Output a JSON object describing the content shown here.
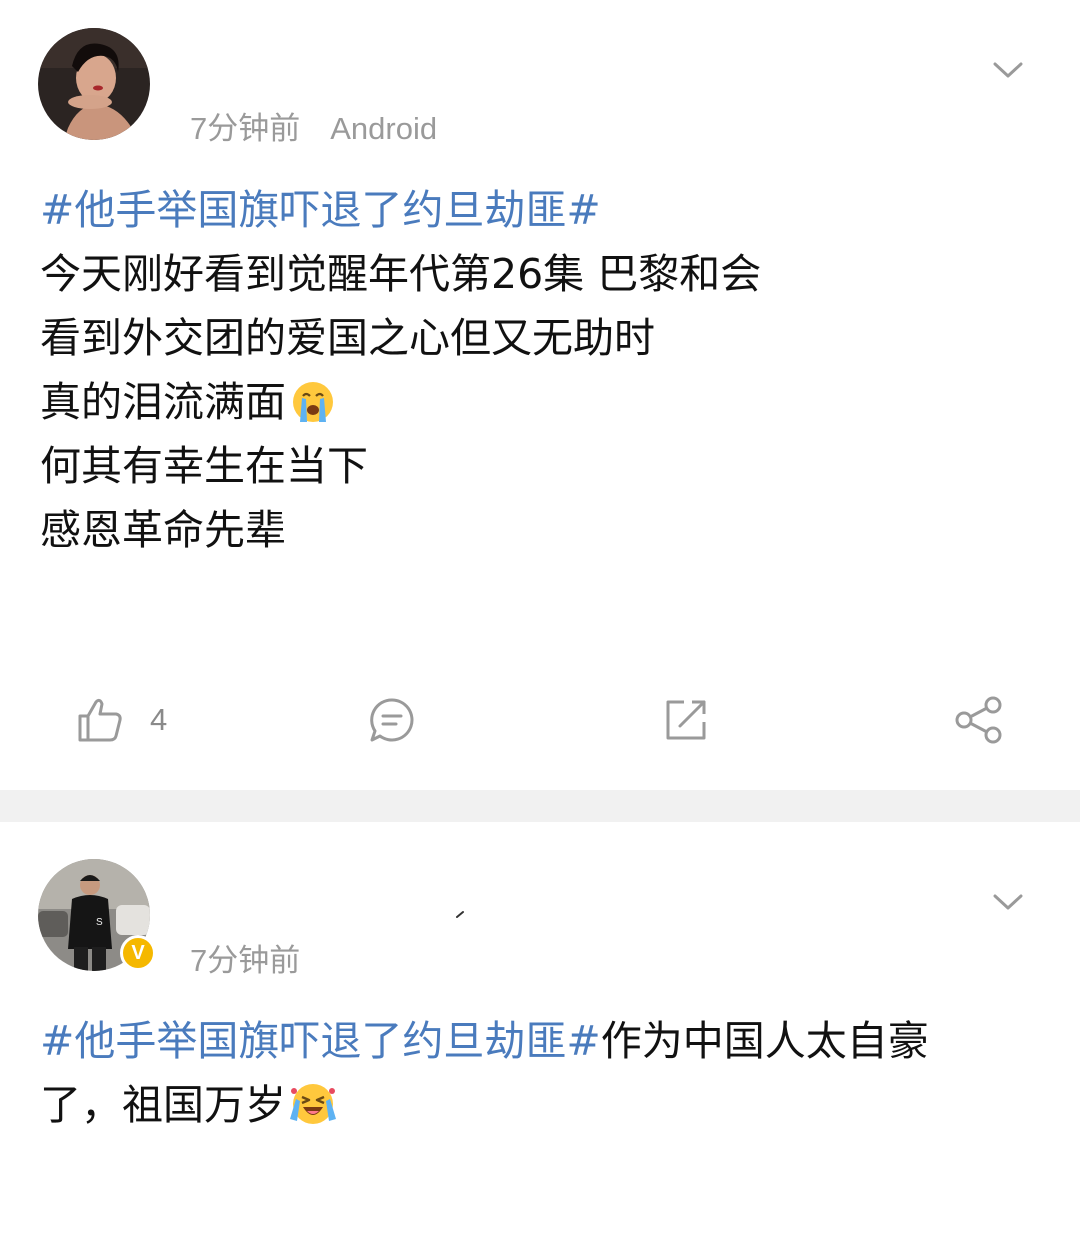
{
  "posts": [
    {
      "time": "7分钟前",
      "device": "Android",
      "hashtag": "#他手举国旗吓退了约旦劫匪#",
      "lines": [
        "今天刚好看到觉醒年代第26集 巴黎和会",
        "看到外交团的爱国之心但又无助时",
        "真的泪流满面",
        "何其有幸生在当下",
        "感恩革命先辈"
      ],
      "emoji": "crying-face",
      "like_count": "4"
    },
    {
      "time": "7分钟前",
      "verified_badge": "V",
      "hashtag": "#他手举国旗吓退了约旦劫匪#",
      "text_after_tag": "作为中国人太自豪",
      "line2": "了，祖国万岁",
      "emoji": "excited-crying-face"
    }
  ],
  "colors": {
    "hashtag": "#4a7bbd",
    "meta": "#9a9a9a",
    "separator": "#f1f1f1",
    "badge": "#f5b800"
  },
  "icons": [
    "chevron-down-icon",
    "like-icon",
    "comment-icon",
    "repost-icon",
    "share-icon"
  ]
}
